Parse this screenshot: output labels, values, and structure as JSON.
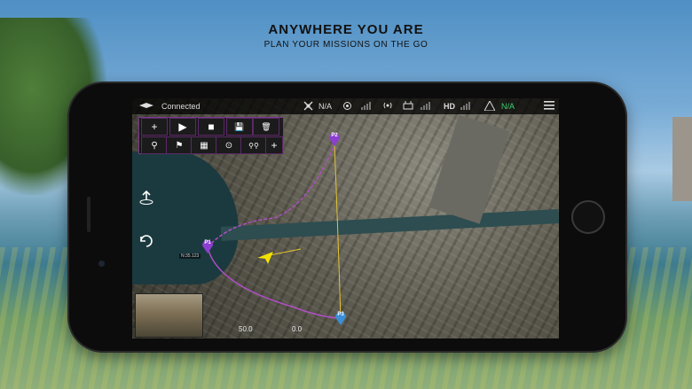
{
  "headline": {
    "title": "ANYWHERE YOU ARE",
    "subtitle": "PLAN YOUR MISSIONS ON THE GO"
  },
  "status_bar": {
    "connection": "Connected",
    "signal_a": "N/A",
    "video_quality": "HD",
    "signal_b": "N/A",
    "accent_green": "#3bd16f"
  },
  "toolbar": {
    "row1": [
      {
        "name": "add-mission-button",
        "glyph": "+"
      },
      {
        "name": "play-button",
        "glyph": "▶"
      },
      {
        "name": "stop-button",
        "glyph": "■"
      },
      {
        "name": "save-button",
        "glyph": "💾"
      },
      {
        "name": "delete-button",
        "glyph": "🗑"
      }
    ],
    "row2": [
      {
        "name": "waypoint-tool-button",
        "glyph": "⚲"
      },
      {
        "name": "flag-tool-button",
        "glyph": "⚑"
      },
      {
        "name": "grid-tool-button",
        "glyph": "▦"
      },
      {
        "name": "focus-tool-button",
        "glyph": "⊙"
      },
      {
        "name": "poi-tool-button",
        "glyph": "⚲⚲"
      },
      {
        "name": "add-tool-button",
        "glyph": "+"
      }
    ],
    "accent": "#7a3a8a"
  },
  "markers": [
    {
      "label": "P2",
      "color": "#8b3fd1"
    },
    {
      "label": "P1",
      "color": "#8b3fd1"
    },
    {
      "label": "P3",
      "color": "#3a8fd6"
    }
  ],
  "map_tags": {
    "p1_coord": "N:35.123"
  },
  "telemetry": {
    "left_value": "50.0",
    "right_value": "0.0"
  }
}
